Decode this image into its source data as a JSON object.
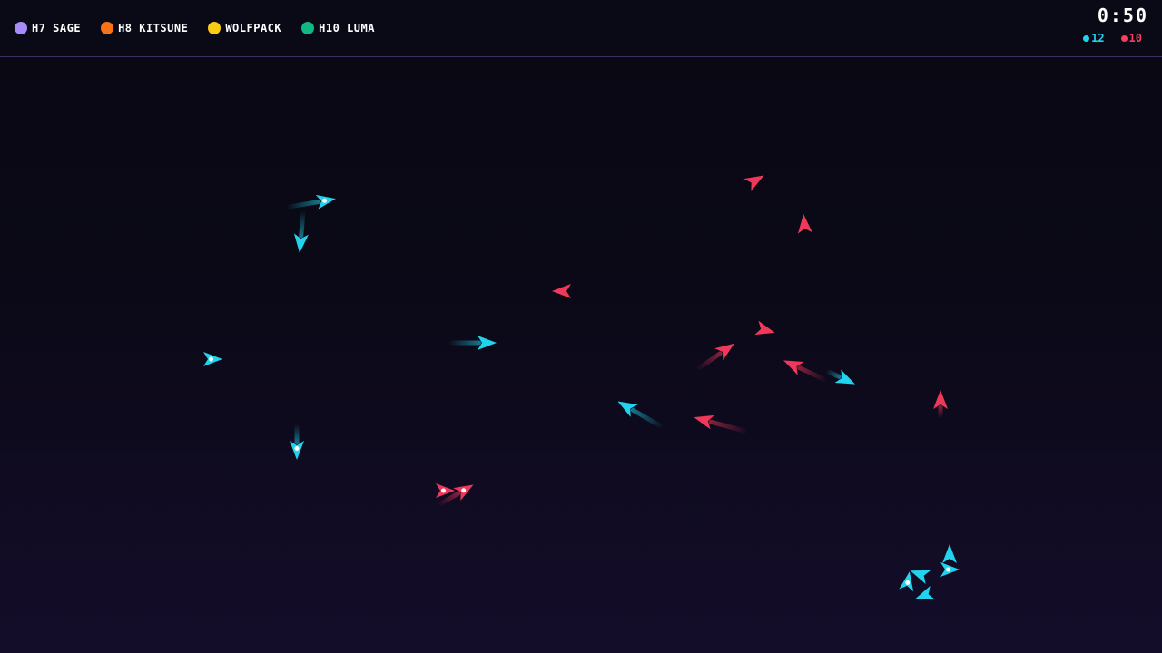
{
  "hud": {
    "players": [
      {
        "name": "H7 SAGE",
        "color": "#a78bfa"
      },
      {
        "name": "H8 KITSUNE",
        "color": "#f97316"
      },
      {
        "name": "WOLFPACK",
        "color": "#facc15"
      },
      {
        "name": "H10 LUMA",
        "color": "#10b981"
      }
    ],
    "timer": "0:50",
    "scores": {
      "cyan": {
        "value": "12",
        "color": "#22d3ee"
      },
      "red": {
        "value": "10",
        "color": "#f43f5e"
      }
    }
  },
  "arena": {
    "team_colors": {
      "cyan": "#22d3ee",
      "red": "#f0385a"
    },
    "ship_icon": "arrow-ship-icon"
  }
}
